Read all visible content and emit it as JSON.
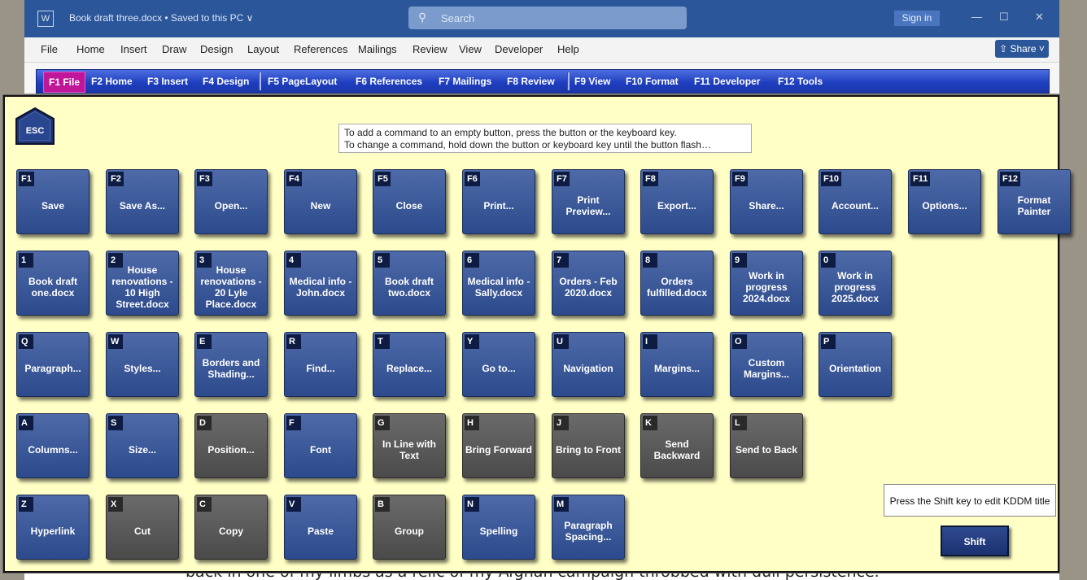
{
  "titlebar": {
    "app_icon": "word-icon",
    "doc_title": "Book draft three.docx • Saved to this PC ∨",
    "search_placeholder": "Search",
    "sign_in": "Sign in",
    "minimize": "—",
    "maximize": "☐",
    "close": "✕"
  },
  "menu": [
    "File",
    "Home",
    "Insert",
    "Draw",
    "Design",
    "Layout",
    "References",
    "Mailings",
    "Review",
    "View",
    "Developer",
    "Help"
  ],
  "share_label": "Share",
  "ftabs": [
    "F1 File",
    "F2 Home",
    "F3 Insert",
    "F4 Design",
    "F5 PageLayout",
    "F6 References",
    "F7 Mailings",
    "F8 Review",
    "F9 View",
    "F10 Format",
    "F11 Developer",
    "F12 Tools"
  ],
  "esc_label": "ESC",
  "info_lines": [
    "To add a command to an empty button, press the button or the keyboard key.",
    "To change a command, hold down the button or keyboard key until the button flash…"
  ],
  "rows": [
    [
      {
        "k": "F1",
        "c": "Save",
        "s": "blue"
      },
      {
        "k": "F2",
        "c": "Save As...",
        "s": "blue"
      },
      {
        "k": "F3",
        "c": "Open...",
        "s": "blue"
      },
      {
        "k": "F4",
        "c": "New",
        "s": "blue"
      },
      {
        "k": "F5",
        "c": "Close",
        "s": "blue"
      },
      {
        "k": "F6",
        "c": "Print...",
        "s": "blue"
      },
      {
        "k": "F7",
        "c": "Print Preview...",
        "s": "blue"
      },
      {
        "k": "F8",
        "c": "Export...",
        "s": "blue"
      },
      {
        "k": "F9",
        "c": "Share...",
        "s": "blue"
      },
      {
        "k": "F10",
        "c": "Account...",
        "s": "blue"
      },
      {
        "k": "F11",
        "c": "Options...",
        "s": "blue"
      },
      {
        "k": "F12",
        "c": "Format Painter",
        "s": "blue"
      }
    ],
    [
      {
        "k": "1",
        "c": "Book draft one.docx",
        "s": "blue"
      },
      {
        "k": "2",
        "c": "House renovations - 10 High Street.docx",
        "s": "blue"
      },
      {
        "k": "3",
        "c": "House renovations - 20 Lyle Place.docx",
        "s": "blue"
      },
      {
        "k": "4",
        "c": "Medical info - John.docx",
        "s": "blue"
      },
      {
        "k": "5",
        "c": "Book draft two.docx",
        "s": "blue"
      },
      {
        "k": "6",
        "c": "Medical info - Sally.docx",
        "s": "blue"
      },
      {
        "k": "7",
        "c": "Orders - Feb 2020.docx",
        "s": "blue"
      },
      {
        "k": "8",
        "c": "Orders fulfilled.docx",
        "s": "blue"
      },
      {
        "k": "9",
        "c": "Work in progress 2024.docx",
        "s": "blue"
      },
      {
        "k": "0",
        "c": "Work in progress 2025.docx",
        "s": "blue"
      }
    ],
    [
      {
        "k": "Q",
        "c": "Paragraph...",
        "s": "blue"
      },
      {
        "k": "W",
        "c": "Styles...",
        "s": "blue"
      },
      {
        "k": "E",
        "c": "Borders and Shading...",
        "s": "blue"
      },
      {
        "k": "R",
        "c": "Find...",
        "s": "blue"
      },
      {
        "k": "T",
        "c": "Replace...",
        "s": "blue"
      },
      {
        "k": "Y",
        "c": "Go to...",
        "s": "blue"
      },
      {
        "k": "U",
        "c": "Navigation",
        "s": "blue"
      },
      {
        "k": "I",
        "c": "Margins...",
        "s": "blue"
      },
      {
        "k": "O",
        "c": "Custom Margins...",
        "s": "blue"
      },
      {
        "k": "P",
        "c": "Orientation",
        "s": "blue"
      }
    ],
    [
      {
        "k": "A",
        "c": "Columns...",
        "s": "blue"
      },
      {
        "k": "S",
        "c": "Size...",
        "s": "blue"
      },
      {
        "k": "D",
        "c": "Position...",
        "s": "gray"
      },
      {
        "k": "F",
        "c": "Font",
        "s": "blue"
      },
      {
        "k": "G",
        "c": "In Line with Text",
        "s": "gray"
      },
      {
        "k": "H",
        "c": "Bring Forward",
        "s": "gray"
      },
      {
        "k": "J",
        "c": "Bring to Front",
        "s": "gray"
      },
      {
        "k": "K",
        "c": "Send Backward",
        "s": "gray"
      },
      {
        "k": "L",
        "c": "Send to Back",
        "s": "gray"
      }
    ],
    [
      {
        "k": "Z",
        "c": "Hyperlink",
        "s": "blue"
      },
      {
        "k": "X",
        "c": "Cut",
        "s": "gray"
      },
      {
        "k": "C",
        "c": "Copy",
        "s": "gray"
      },
      {
        "k": "V",
        "c": "Paste",
        "s": "blue"
      },
      {
        "k": "B",
        "c": "Group",
        "s": "gray"
      },
      {
        "k": "N",
        "c": "Spelling",
        "s": "blue"
      },
      {
        "k": "M",
        "c": "Paragraph Spacing...",
        "s": "blue"
      }
    ]
  ],
  "shift_hint": "Press the Shift key to edit KDDM title",
  "shift_label": "Shift",
  "background_text": "back in one of my limbs as a relic of my Afghan campaign throbbed with dull persistence."
}
